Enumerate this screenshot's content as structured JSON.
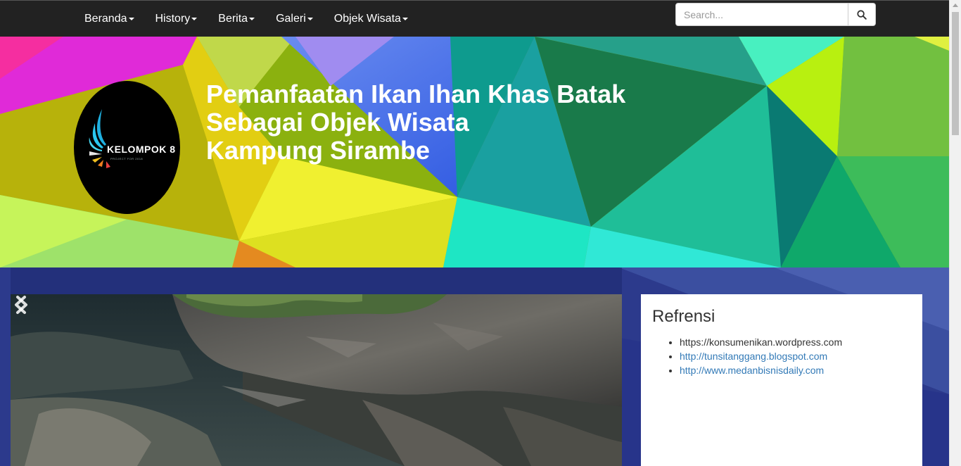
{
  "navbar": {
    "items": [
      {
        "label": "Beranda"
      },
      {
        "label": "History"
      },
      {
        "label": "Berita"
      },
      {
        "label": "Galeri"
      },
      {
        "label": "Objek Wisata"
      }
    ],
    "search": {
      "placeholder": "Search..."
    }
  },
  "header": {
    "logo": {
      "text": "KELOMPOK 8",
      "subtext": "PROJECT FOR 2018"
    },
    "title_lines": [
      "Pemanfaatan Ikan Ihan Khas Batak",
      "Sebagai Objek Wisata",
      "Kampung Sirambe"
    ]
  },
  "sidebar": {
    "title": "Refrensi",
    "links": [
      {
        "text": "https://konsumenikan.wordpress.com",
        "style": "plain"
      },
      {
        "text": "http://tunsitanggang.blogspot.com",
        "style": "link"
      },
      {
        "text": "http://www.medanbisnisdaily.com",
        "style": "link"
      }
    ]
  },
  "colors": {
    "navbar_bg": "#222222",
    "link": "#337ab7",
    "content_bg": "#2d3b8e"
  },
  "icons": {
    "search": "magnifier-icon",
    "carousel_prev": "chevron-left-icon",
    "carousel_next": "chevron-right-icon"
  }
}
